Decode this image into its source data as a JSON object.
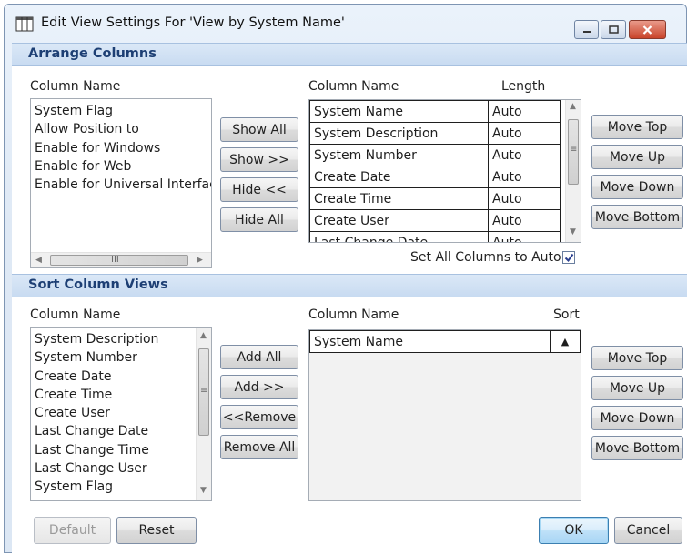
{
  "window": {
    "title": "Edit View Settings For 'View by System Name'"
  },
  "arrange": {
    "header": "Arrange Columns",
    "available_label": "Column Name",
    "available_items": [
      "System Flag",
      "Allow Position to",
      "Enable for Windows",
      "Enable for Web",
      "Enable for Universal Interface"
    ],
    "buttons": {
      "show_all": "Show All",
      "show": "Show >>",
      "hide": "Hide <<",
      "hide_all": "Hide All"
    },
    "grid_label_name": "Column Name",
    "grid_label_length": "Length",
    "grid_rows": [
      {
        "name": "System Name",
        "length": "Auto"
      },
      {
        "name": "System Description",
        "length": "Auto"
      },
      {
        "name": "System Number",
        "length": "Auto"
      },
      {
        "name": "Create Date",
        "length": "Auto"
      },
      {
        "name": "Create Time",
        "length": "Auto"
      },
      {
        "name": "Create User",
        "length": "Auto"
      },
      {
        "name": "Last Change Date",
        "length": "Auto"
      }
    ],
    "set_all_auto_label": "Set All Columns to Auto",
    "set_all_auto_checked": true,
    "move_buttons": {
      "top": "Move Top",
      "up": "Move Up",
      "down": "Move Down",
      "bottom": "Move Bottom"
    },
    "hscroll_grip": "III"
  },
  "sort": {
    "header": "Sort Column Views",
    "available_label": "Column Name",
    "available_items": [
      "System Description",
      "System Number",
      "Create Date",
      "Create Time",
      "Create User",
      "Last Change Date",
      "Last Change Time",
      "Last Change User",
      "System Flag"
    ],
    "buttons": {
      "add_all": "Add All",
      "add": "Add >>",
      "remove": "<<Remove",
      "remove_all": "Remove All"
    },
    "grid_label_name": "Column Name",
    "grid_label_sort": "Sort",
    "grid_rows": [
      {
        "name": "System Name",
        "sort": "▲"
      }
    ],
    "move_buttons": {
      "top": "Move Top",
      "up": "Move Up",
      "down": "Move Down",
      "bottom": "Move Bottom"
    }
  },
  "footer": {
    "default": "Default",
    "reset": "Reset",
    "ok": "OK",
    "cancel": "Cancel"
  },
  "icons": {
    "app": "columns-icon",
    "minimize": "minimize-icon",
    "maximize": "maximize-icon",
    "close": "close-icon",
    "scroll_up": "chevron-up-icon",
    "scroll_down": "chevron-down-icon",
    "scroll_left": "chevron-left-icon",
    "scroll_right": "chevron-right-icon",
    "checkmark": "checkmark-icon"
  },
  "colors": {
    "section_header_text": "#1d3f74",
    "section_header_bg": "#c8dbf1",
    "close_button": "#c9442b",
    "ok_button_border": "#3c7fb1"
  }
}
